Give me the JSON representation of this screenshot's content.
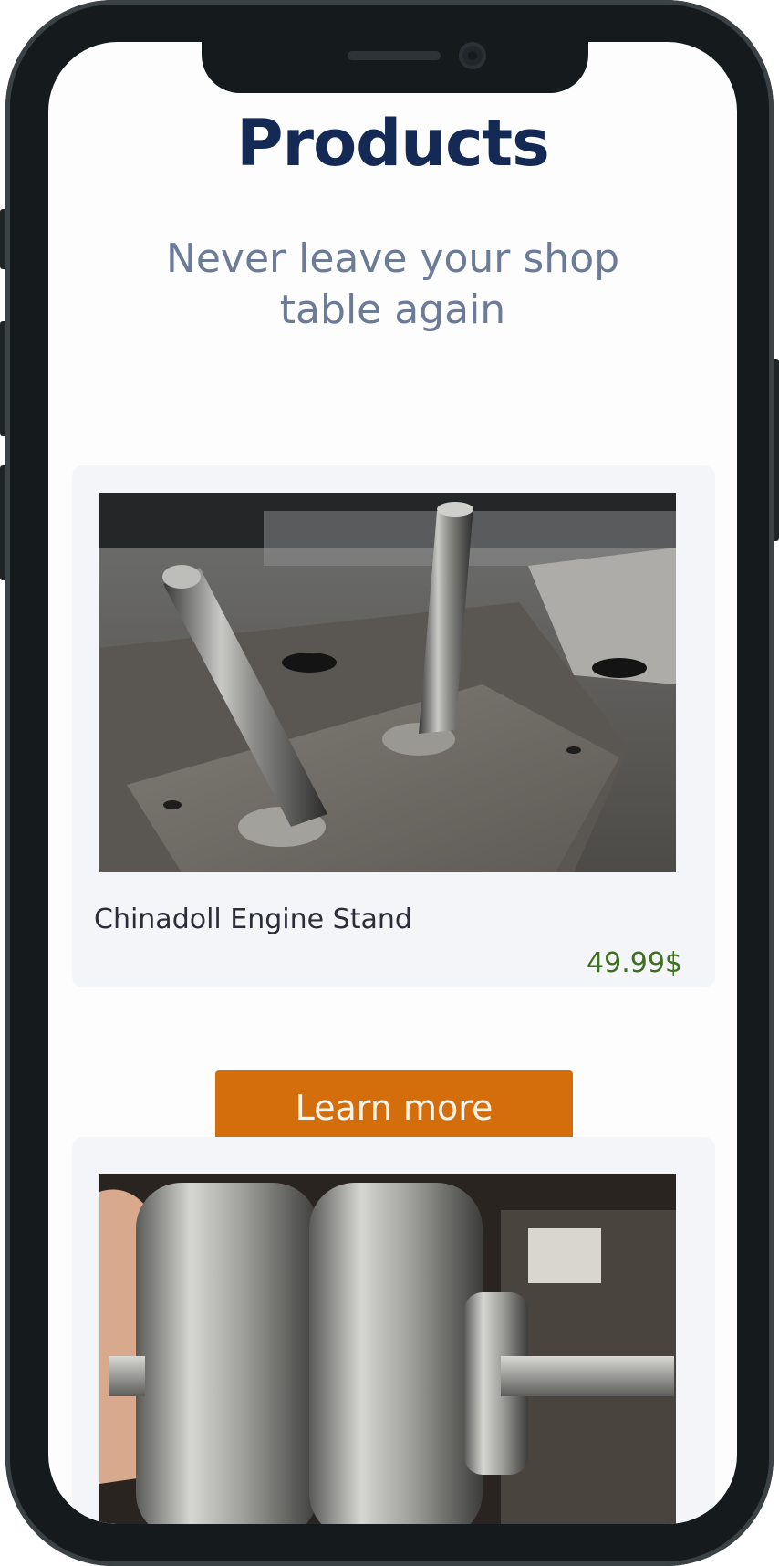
{
  "page": {
    "title": "Products",
    "subtitle": "Never leave your shop table again"
  },
  "products": [
    {
      "name": "Chinadoll Engine Stand",
      "price": "49.99$",
      "image": "welded-steel-pins-on-plate-photo",
      "button_label": "Learn more"
    },
    {
      "image": "steel-pulley-wheels-photo"
    }
  ],
  "colors": {
    "title": "#142a55",
    "subtitle": "#6b7b98",
    "price": "#3e6f22",
    "button": "#d46d0b",
    "card_bg": "#f4f5f8",
    "phone_frame": "#151a1c"
  }
}
